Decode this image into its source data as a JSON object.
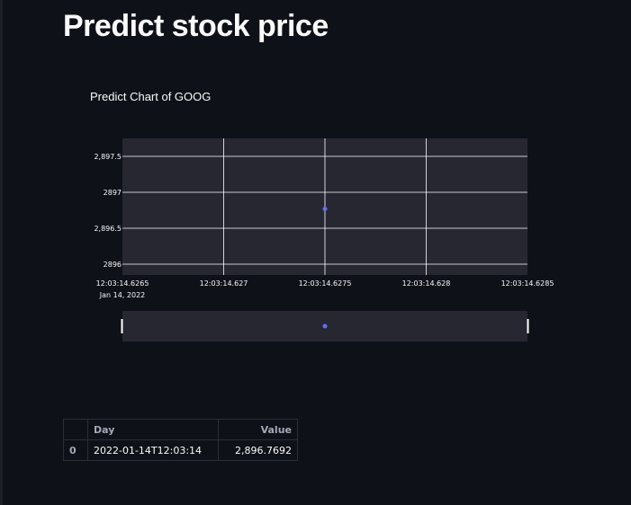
{
  "page": {
    "title": "Predict stock price"
  },
  "chart_data": {
    "type": "scatter",
    "title": "Predict Chart of GOOG",
    "x_tick_labels": [
      "12:03:14.6265",
      "12:03:14.627",
      "12:03:14.6275",
      "12:03:14.628",
      "12:03:14.6285"
    ],
    "x_date_label": "Jan 14, 2022",
    "y_tick_labels": [
      "2,897.5",
      "2897",
      "2,896.5",
      "2896"
    ],
    "y_ticks": [
      2897.5,
      2897,
      2896.5,
      2896
    ],
    "ylim": [
      2895.85,
      2897.75
    ],
    "xlim": [
      "2022-01-14T12:03:14.6265",
      "2022-01-14T12:03:14.6285"
    ],
    "points": [
      {
        "x": "2022-01-14T12:03:14.6275",
        "y": 2896.7692
      }
    ],
    "grid": true,
    "range_slider": true,
    "colors": {
      "marker": "#636efa",
      "plot_bg": "#262730",
      "grid": "#ffffff"
    }
  },
  "table": {
    "columns": [
      "",
      "Day",
      "Value"
    ],
    "rows": [
      {
        "index": "0",
        "day": "2022-01-14T12:03:14",
        "value": "2,896.7692"
      }
    ]
  }
}
